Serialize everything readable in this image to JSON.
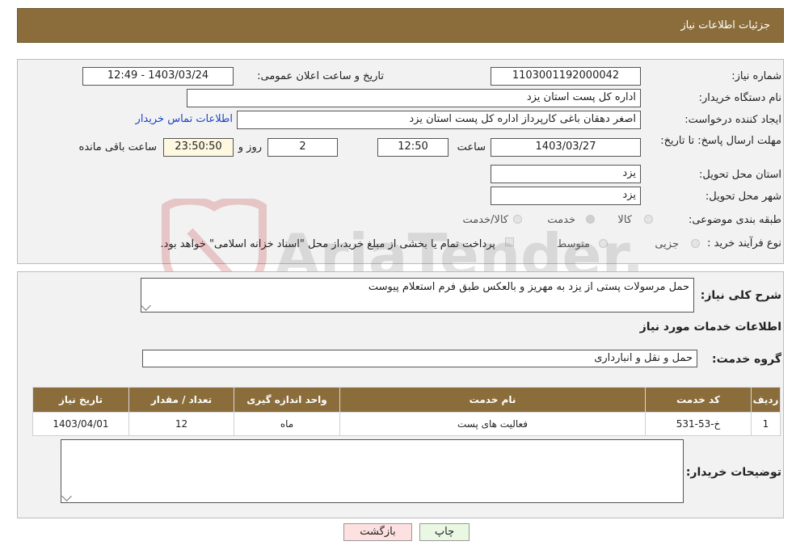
{
  "header": {
    "title": "جزئیات اطلاعات نیاز"
  },
  "details": {
    "need_number_label": "شماره نیاز:",
    "need_number": "1103001192000042",
    "announce_label": "تاریخ و ساعت اعلان عمومی:",
    "announce_value": "1403/03/24 - 12:49",
    "buyer_org_label": "نام دستگاه خریدار:",
    "buyer_org": "اداره کل پست استان یزد",
    "creator_label": "ایجاد کننده درخواست:",
    "creator": "اصغر دهقان باغی کارپرداز اداره کل پست استان یزد",
    "contact_link": "اطلاعات تماس خریدار",
    "deadline_label": "مهلت ارسال پاسخ: تا تاریخ:",
    "deadline_date": "1403/03/27",
    "time_label": "ساعت",
    "deadline_time": "12:50",
    "days": "2",
    "days_label": "روز و",
    "remaining": "23:50:50",
    "remaining_label": "ساعت باقی مانده",
    "province_label": "استان محل تحویل:",
    "province": "یزد",
    "city_label": "شهر محل تحویل:",
    "city": "یزد",
    "category_label": "طبقه بندی موضوعی:",
    "category_options": [
      "کالا",
      "خدمت",
      "کالا/خدمت"
    ],
    "category_selected": "خدمت",
    "process_label": "نوع فرآیند خرید :",
    "process_options": [
      "جزیی",
      "متوسط"
    ],
    "process_note": "پرداخت تمام یا بخشی از مبلغ خرید،از محل \"اسناد خزانه اسلامی\" خواهد بود."
  },
  "description": {
    "label": "شرح کلی نیاز:",
    "text": "حمل مرسولات پستی از یزد به مهریز و بالعکس طبق فرم استعلام پیوست"
  },
  "services": {
    "section_title": "اطلاعات خدمات مورد نیاز",
    "group_label": "گروه خدمت:",
    "group_value": "حمل و نقل و انبارداری",
    "columns": [
      "ردیف",
      "کد خدمت",
      "نام خدمت",
      "واحد اندازه گیری",
      "تعداد / مقدار",
      "تاریخ نیاز"
    ],
    "rows": [
      [
        "1",
        "خ-53-531",
        "فعالیت های پست",
        "ماه",
        "12",
        "1403/04/01"
      ]
    ]
  },
  "buyer_notes": {
    "label": "توضیحات خریدار:",
    "text": ""
  },
  "buttons": {
    "print": "چاپ",
    "back": "بازگشت"
  },
  "watermark": {
    "text": "AriaTender.neT"
  },
  "colors": {
    "header_bg": "#8a6d3b",
    "link": "#1a44c8",
    "back_btn": "#fde0e0",
    "print_btn": "#eaf7e3"
  }
}
